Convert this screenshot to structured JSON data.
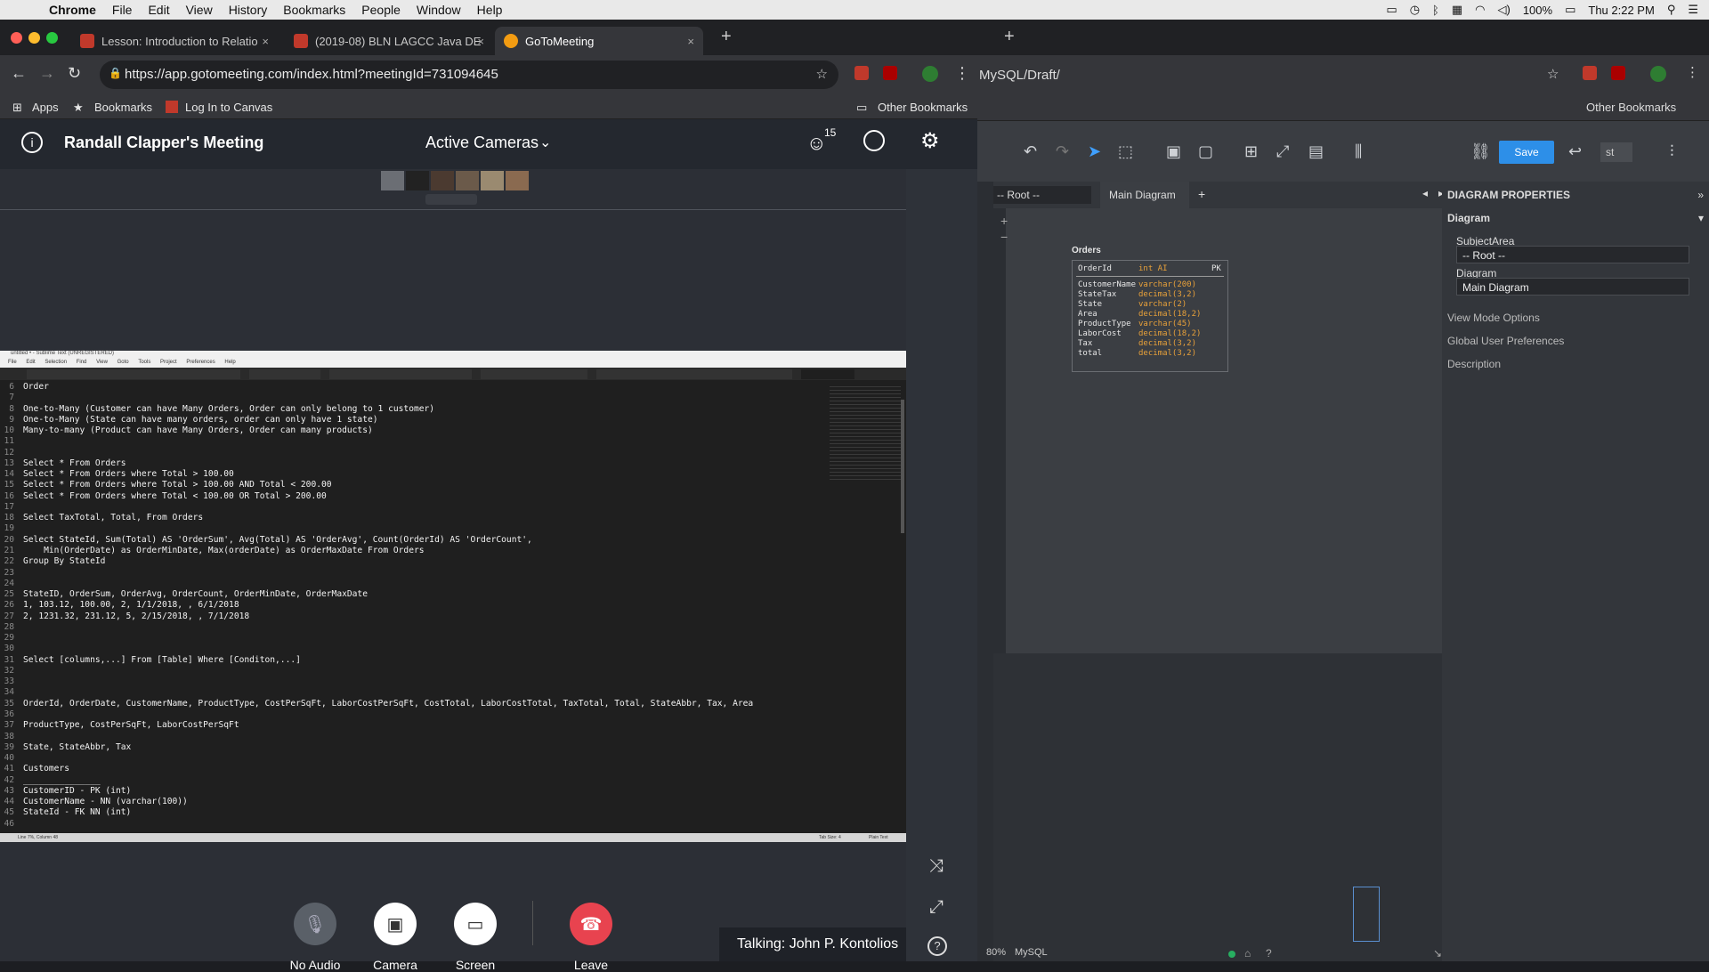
{
  "menubar": {
    "app": "Chrome",
    "items": [
      "File",
      "Edit",
      "View",
      "History",
      "Bookmarks",
      "People",
      "Window",
      "Help"
    ],
    "battery": "100%",
    "clock": "Thu 2:22 PM"
  },
  "browser": {
    "tabs": [
      {
        "title": "Lesson: Introduction to Relatio"
      },
      {
        "title": "(2019-08) BLN LAGCC Java DE"
      },
      {
        "title": "GoToMeeting"
      }
    ],
    "url": "https://app.gotomeeting.com/index.html?meetingId=731094645",
    "bookmarks": {
      "apps": "Apps",
      "bookmarks": "Bookmarks",
      "canvas": "Log In to Canvas",
      "other": "Other Bookmarks"
    }
  },
  "meeting": {
    "title": "Randall Clapper's Meeting",
    "view_mode": "Active Cameras",
    "attendee_count": "15",
    "controls": {
      "audio": "No Audio",
      "camera": "Camera",
      "screen": "Screen",
      "leave": "Leave"
    },
    "talking": "Talking: John P. Kontolios"
  },
  "editor": {
    "title": "untitled • - Sublime Text (UNREGISTERED)",
    "menu": [
      "File",
      "Edit",
      "Selection",
      "Find",
      "View",
      "Goto",
      "Tools",
      "Project",
      "Preferences",
      "Help"
    ],
    "status_left": "Line 7%, Column 48",
    "status_mid": "Tab Size: 4",
    "status_right": "Plain Text",
    "lines": [
      {
        "n": "6",
        "t": "Order"
      },
      {
        "n": "7",
        "t": ""
      },
      {
        "n": "8",
        "t": "One-to-Many (Customer can have Many Orders, Order can only belong to 1 customer)"
      },
      {
        "n": "9",
        "t": "One-to-Many (State can have many orders, order can only have 1 state)"
      },
      {
        "n": "10",
        "t": "Many-to-many (Product can have Many Orders, Order can many products)"
      },
      {
        "n": "11",
        "t": ""
      },
      {
        "n": "12",
        "t": ""
      },
      {
        "n": "13",
        "t": "Select * From Orders"
      },
      {
        "n": "14",
        "t": "Select * From Orders where Total > 100.00"
      },
      {
        "n": "15",
        "t": "Select * From Orders where Total > 100.00 AND Total < 200.00"
      },
      {
        "n": "16",
        "t": "Select * From Orders where Total < 100.00 OR Total > 200.00"
      },
      {
        "n": "17",
        "t": ""
      },
      {
        "n": "18",
        "t": "Select TaxTotal, Total, From Orders"
      },
      {
        "n": "19",
        "t": ""
      },
      {
        "n": "20",
        "t": "Select StateId, Sum(Total) AS 'OrderSum', Avg(Total) AS 'OrderAvg', Count(OrderId) AS 'OrderCount',"
      },
      {
        "n": "21",
        "t": "    Min(OrderDate) as OrderMinDate, Max(orderDate) as OrderMaxDate From Orders"
      },
      {
        "n": "22",
        "t": "Group By StateId"
      },
      {
        "n": "23",
        "t": ""
      },
      {
        "n": "24",
        "t": ""
      },
      {
        "n": "25",
        "t": "StateID, OrderSum, OrderAvg, OrderCount, OrderMinDate, OrderMaxDate"
      },
      {
        "n": "26",
        "t": "1, 103.12, 100.00, 2, 1/1/2018, , 6/1/2018"
      },
      {
        "n": "27",
        "t": "2, 1231.32, 231.12, 5, 2/15/2018, , 7/1/2018"
      },
      {
        "n": "28",
        "t": ""
      },
      {
        "n": "29",
        "t": ""
      },
      {
        "n": "30",
        "t": ""
      },
      {
        "n": "31",
        "t": "Select [columns,...] From [Table] Where [Conditon,...]"
      },
      {
        "n": "32",
        "t": ""
      },
      {
        "n": "33",
        "t": ""
      },
      {
        "n": "34",
        "t": ""
      },
      {
        "n": "35",
        "t": "OrderId, OrderDate, CustomerName, ProductType, CostPerSqFt, LaborCostPerSqFt, CostTotal, LaborCostTotal, TaxTotal, Total, StateAbbr, Tax, Area"
      },
      {
        "n": "36",
        "t": ""
      },
      {
        "n": "37",
        "t": "ProductType, CostPerSqFt, LaborCostPerSqFt"
      },
      {
        "n": "38",
        "t": ""
      },
      {
        "n": "39",
        "t": "State, StateAbbr, Tax"
      },
      {
        "n": "40",
        "t": ""
      },
      {
        "n": "41",
        "t": "Customers"
      },
      {
        "n": "42",
        "t": "_______________"
      },
      {
        "n": "43",
        "t": "CustomerID - PK (int)"
      },
      {
        "n": "44",
        "t": "CustomerName - NN (varchar(100))"
      },
      {
        "n": "45",
        "t": "StateId - FK NN (int)"
      },
      {
        "n": "46",
        "t": ""
      }
    ]
  },
  "diagram_tool": {
    "url_fragment": "MySQL/Draft/",
    "other_bookmarks": "Other Bookmarks",
    "save_label": "Save",
    "user_badge": "st",
    "root_select": "-- Root --",
    "tab_main": "Main Diagram",
    "props_title": "DIAGRAM PROPERTIES",
    "section_diagram": "Diagram",
    "subject_area_label": "SubjectArea",
    "subject_area_value": "-- Root --",
    "diagram_label": "Diagram",
    "diagram_value": "Main Diagram",
    "view_mode": "View Mode Options",
    "global_prefs": "Global User Preferences",
    "description": "Description",
    "zoom": "80%",
    "db": "MySQL",
    "table": {
      "name": "Orders",
      "pk": {
        "col": "OrderId",
        "type": "int AI",
        "key": "PK"
      },
      "columns": [
        {
          "col": "CustomerName",
          "type": "varchar(200)"
        },
        {
          "col": "StateTax",
          "type": "decimal(3,2)"
        },
        {
          "col": "State",
          "type": "varchar(2)"
        },
        {
          "col": "Area",
          "type": "decimal(18,2)"
        },
        {
          "col": "ProductType",
          "type": "varchar(45)"
        },
        {
          "col": "LaborCost",
          "type": "decimal(18,2)"
        },
        {
          "col": "Tax",
          "type": "decimal(3,2)"
        },
        {
          "col": "total",
          "type": "decimal(3,2)"
        }
      ]
    }
  }
}
